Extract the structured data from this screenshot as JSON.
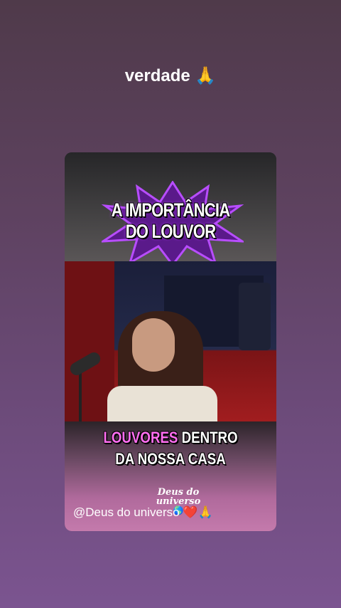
{
  "story": {
    "caption_text": "verdade",
    "caption_emoji": "🙏",
    "card": {
      "headline_line1": "A IMPORTÂNCIA",
      "headline_line2": "DO LOUVOR",
      "subtitle_highlight": "LOUVORES",
      "subtitle_rest": " DENTRO",
      "subtitle_line2": "DA NOSSA CASA",
      "logo_line1": "Deus do",
      "logo_line2": "universo",
      "logo_globe": "🌎",
      "mention_text": "@Deus do universo",
      "mention_emojis": "❤️🙏"
    }
  },
  "colors": {
    "background_top": "#4f3a4a",
    "background_bottom": "#7b5490",
    "highlight_pink": "#ff6ef0",
    "burst_purple": "#a13cff"
  },
  "icons": [
    "praying-hands-emoji",
    "globe-emoji",
    "heart-emoji",
    "microphone"
  ]
}
